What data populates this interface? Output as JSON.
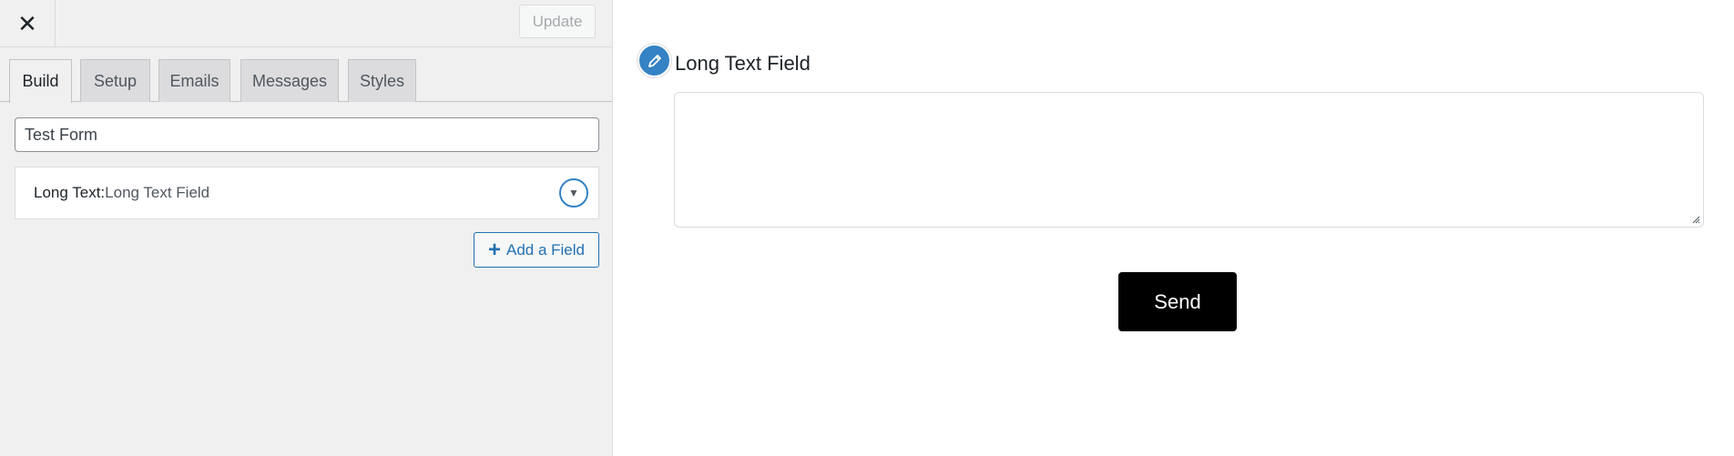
{
  "header": {
    "close_icon": "close-icon",
    "update_label": "Update"
  },
  "tabs": [
    {
      "label": "Build",
      "active": true
    },
    {
      "label": "Setup",
      "active": false
    },
    {
      "label": "Emails",
      "active": false
    },
    {
      "label": "Messages",
      "active": false
    },
    {
      "label": "Styles",
      "active": false
    }
  ],
  "build": {
    "form_name": "Test Form",
    "fields": [
      {
        "type": "Long Text",
        "separator": ": ",
        "label": "Long Text Field",
        "toggle_icon": "chevron-down-icon"
      }
    ],
    "add_field_label": "Add a Field",
    "add_field_icon": "plus-icon"
  },
  "preview": {
    "edit_icon": "pencil-icon",
    "field_title": "Long Text Field",
    "field_value": "",
    "send_label": "Send"
  },
  "colors": {
    "accent": "#3582c4",
    "link": "#2271b1",
    "send_background": "#000000",
    "sidebar_background": "#f0f0f0"
  }
}
